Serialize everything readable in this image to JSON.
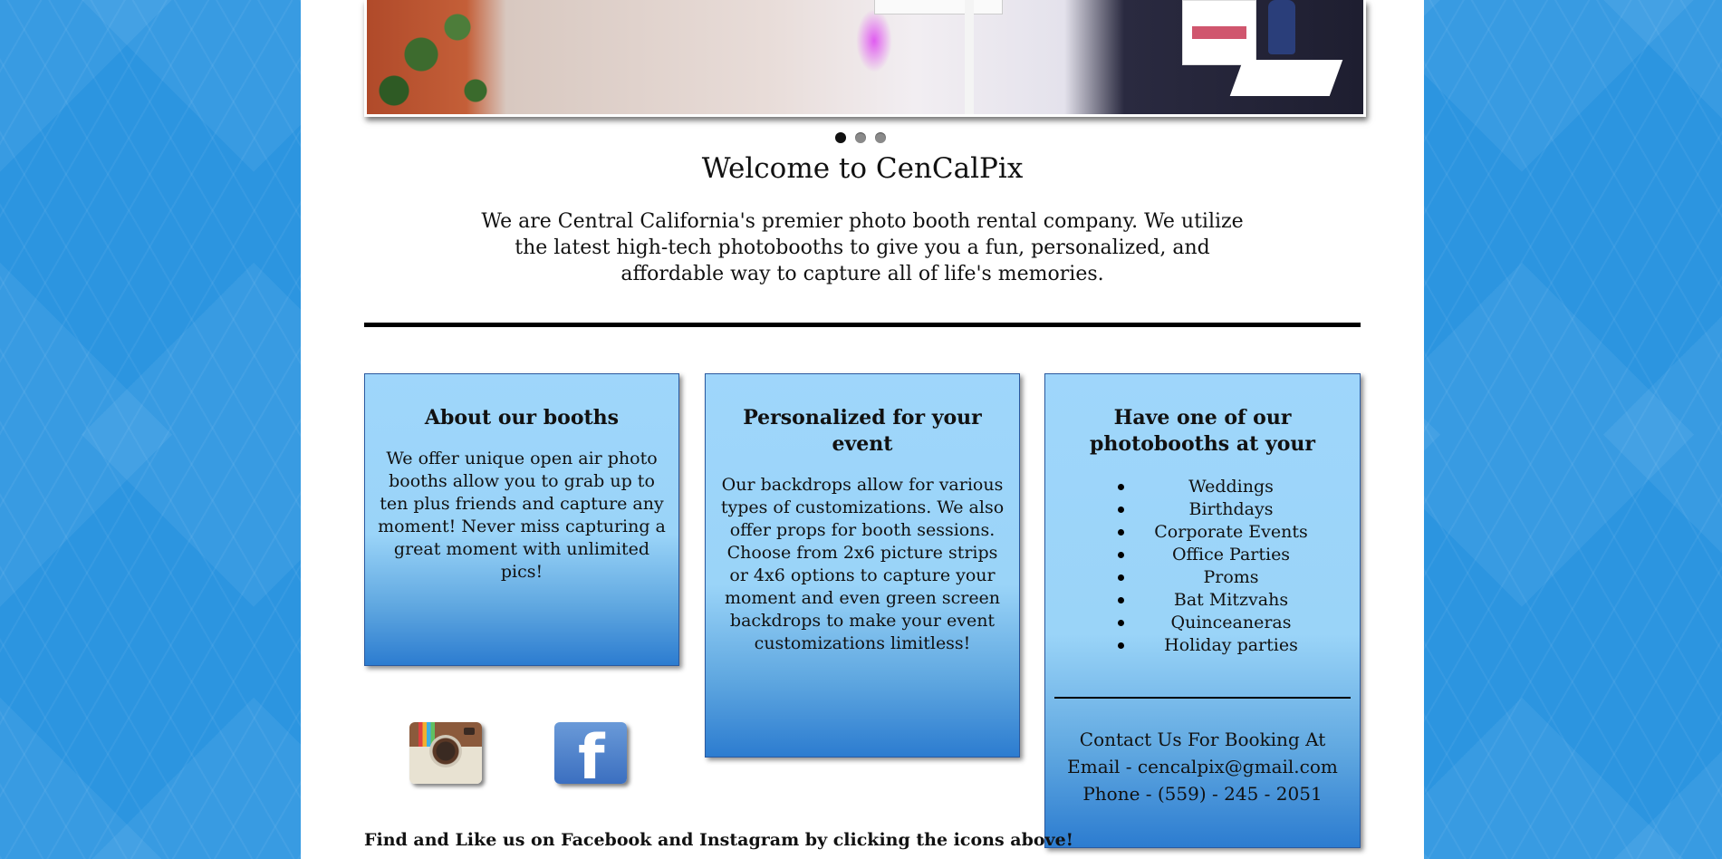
{
  "hero": {
    "dots": 3,
    "active_dot": 0
  },
  "welcome": {
    "title": "Welcome to CenCalPix",
    "intro": "We are Central California's premier photo booth rental company. We utilize the latest high-tech photobooths to give you a fun, personalized, and affordable way to capture all of life's memories."
  },
  "boxes": {
    "about": {
      "title": "About our booths",
      "text": "We offer unique open air photo booths allow you to grab up to ten plus friends and capture any moment! Never miss capturing a great moment with unlimited pics!"
    },
    "personalized": {
      "title": "Personalized for your event",
      "text": "Our backdrops allow for various types of customizations. We also offer props for booth sessions. Choose from 2x6 picture strips or 4x6 options to capture your moment and even green screen backdrops to make your event customizations limitless!"
    },
    "events": {
      "title": "Have one of our photobooths at your",
      "items": [
        "Weddings",
        "Birthdays",
        "Corporate Events",
        "Office Parties",
        "Proms",
        "Bat Mitzvahs",
        "Quinceaneras",
        "Holiday parties"
      ],
      "contact_heading": "Contact Us For Booking At",
      "email": "Email - cencalpix@gmail.com",
      "phone": "Phone - (559) - 245 - 2051"
    }
  },
  "social": {
    "instagram_icon": "instagram-icon",
    "facebook_icon": "facebook-icon",
    "facebook_glyph": "f",
    "caption": "Find and Like us on Facebook and Instagram by clicking the icons above!"
  }
}
